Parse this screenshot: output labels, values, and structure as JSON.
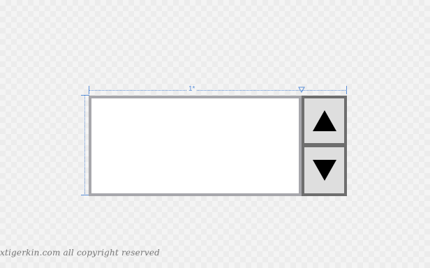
{
  "designer": {
    "column_width_label": "1*"
  },
  "numeric_updown": {
    "value": "",
    "up_icon": "arrow-up-icon",
    "down_icon": "arrow-down-icon",
    "field_border_color": "#a7a7ac",
    "button_background": "#dedede",
    "button_frame_color": "#6e6e6e"
  },
  "watermark": {
    "text": "xtigerkin.com all copyright reserved"
  }
}
